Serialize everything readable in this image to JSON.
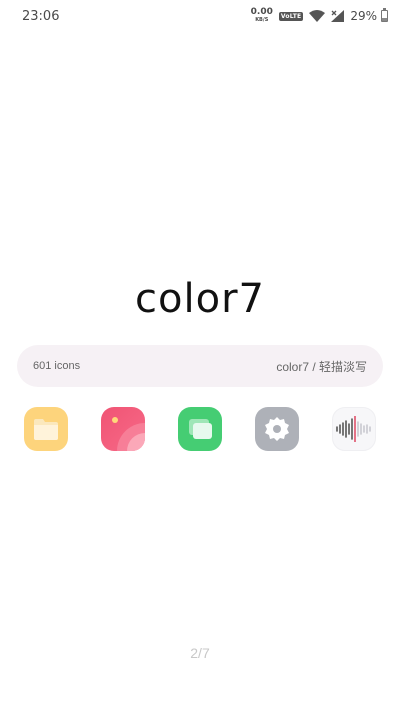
{
  "status_bar": {
    "time": "23:06",
    "net_speed_value": "0.00",
    "net_speed_unit": "KB/S",
    "volte": "VoLTE",
    "battery_percent": "29%",
    "battery_level": 0.29
  },
  "brand": {
    "title": "color7"
  },
  "info_pill": {
    "icon_count": "601 icons",
    "author": "color7 / 轻描淡写"
  },
  "app_icons": [
    {
      "name": "files-icon",
      "color": "#fdd47c"
    },
    {
      "name": "gallery-icon",
      "color": "#f05474"
    },
    {
      "name": "messages-icon",
      "color": "#45cd73"
    },
    {
      "name": "settings-icon",
      "color": "#aeb1b8"
    },
    {
      "name": "recorder-icon",
      "color": "#f7f7f9"
    }
  ],
  "pager": {
    "indicator": "2/7"
  }
}
